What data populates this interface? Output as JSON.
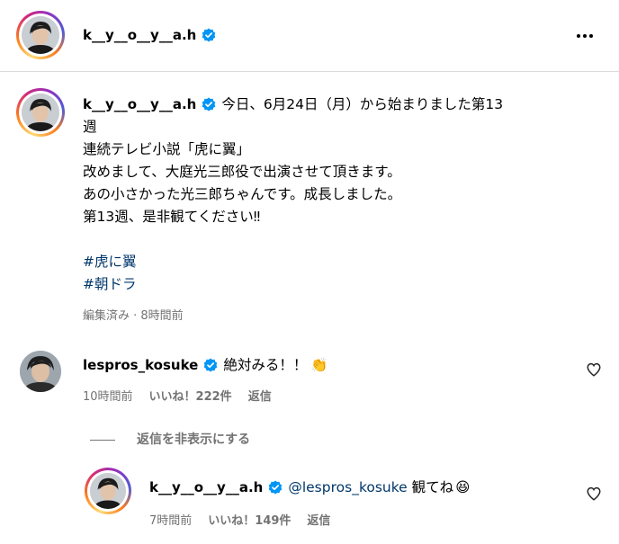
{
  "header": {
    "username": "k__y__o__y__a.h",
    "icons": {
      "verified": "verified-badge-icon",
      "more": "more-options-icon"
    }
  },
  "post": {
    "username": "k__y__o__y__a.h",
    "caption_lines": [
      "今日、6月24日（月）から始まりました第13",
      "週",
      "連続テレビ小説「虎に翼」",
      "改めまして、大庭光三郎役で出演させて頂きます。",
      "あの小さかった光三郎ちゃんです。成長しました。",
      "第13週、是非観てください‼︎"
    ],
    "hashtags": [
      "#虎に翼",
      "#朝ドラ"
    ],
    "meta": "編集済み · 8時間前"
  },
  "comments": [
    {
      "username": "lespros_kosuke",
      "text": "絶対みる！！",
      "emoji": "👏",
      "time": "10時間前",
      "likes": "いいね！222件",
      "reply_label": "返信"
    }
  ],
  "hide_replies_label": "返信を非表示にする",
  "reply": {
    "username": "k__y__o__y__a.h",
    "mention": "@lespros_kosuke",
    "text": "観てね",
    "emoji": "😆",
    "time": "7時間前",
    "likes": "いいね！149件",
    "reply_label": "返信"
  },
  "colors": {
    "verified": "#0095f6",
    "link": "#00376b",
    "secondary": "#737373",
    "divider": "#dbdbdb"
  }
}
